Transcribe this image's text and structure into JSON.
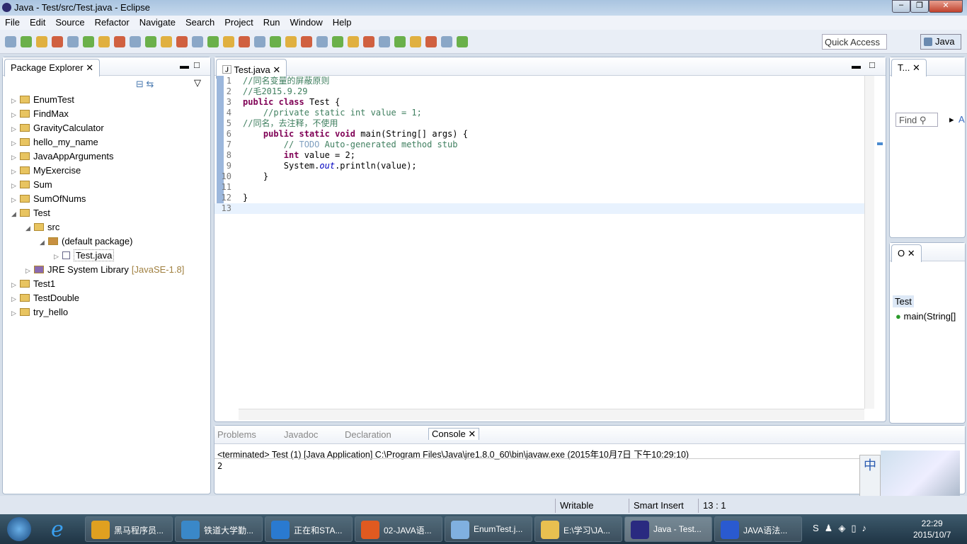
{
  "window": {
    "title": "Java - Test/src/Test.java - Eclipse"
  },
  "menu": [
    "File",
    "Edit",
    "Source",
    "Refactor",
    "Navigate",
    "Search",
    "Project",
    "Run",
    "Window",
    "Help"
  ],
  "toolbar": {
    "quick_access_placeholder": "Quick Access",
    "perspective": "Java"
  },
  "package_explorer": {
    "title": "Package Explorer",
    "items": [
      {
        "label": "EnumTest",
        "level": 0,
        "expanded": false,
        "icon": "project-folder-icon"
      },
      {
        "label": "FindMax",
        "level": 0,
        "expanded": false,
        "icon": "project-folder-icon"
      },
      {
        "label": "GravityCalculator",
        "level": 0,
        "expanded": false,
        "icon": "project-folder-icon"
      },
      {
        "label": "hello_my_name",
        "level": 0,
        "expanded": false,
        "icon": "project-folder-icon"
      },
      {
        "label": "JavaAppArguments",
        "level": 0,
        "expanded": false,
        "icon": "project-folder-icon"
      },
      {
        "label": "MyExercise",
        "level": 0,
        "expanded": false,
        "icon": "project-folder-icon"
      },
      {
        "label": "Sum",
        "level": 0,
        "expanded": false,
        "icon": "project-folder-icon"
      },
      {
        "label": "SumOfNums",
        "level": 0,
        "expanded": false,
        "icon": "project-folder-icon"
      },
      {
        "label": "Test",
        "level": 0,
        "expanded": true,
        "icon": "project-folder-icon"
      },
      {
        "label": "src",
        "level": 1,
        "expanded": true,
        "icon": "source-folder-icon"
      },
      {
        "label": "(default package)",
        "level": 2,
        "expanded": true,
        "icon": "package-icon"
      },
      {
        "label": "Test.java",
        "level": 3,
        "expanded": false,
        "icon": "java-file-icon"
      },
      {
        "label": "JRE System Library",
        "suffix": "[JavaSE-1.8]",
        "level": 1,
        "expanded": false,
        "icon": "library-icon"
      },
      {
        "label": "Test1",
        "level": 0,
        "expanded": false,
        "icon": "project-folder-icon"
      },
      {
        "label": "TestDouble",
        "level": 0,
        "expanded": false,
        "icon": "project-folder-icon"
      },
      {
        "label": "try_hello",
        "level": 0,
        "expanded": false,
        "icon": "project-folder-icon"
      }
    ]
  },
  "editor": {
    "tab": "Test.java",
    "lines": [
      "//同名变量的屏蔽原则",
      "//毛2015.9.29",
      "public class Test {",
      "    //private static int value = 1;",
      "//同名，去注释，不使用",
      "    public static void main(String[] args) {",
      "        // TODO Auto-generated method stub",
      "        int value = 2;",
      "        System.out.println(value);",
      "    }",
      "",
      "}",
      ""
    ]
  },
  "console": {
    "tabs": [
      "Problems",
      "Javadoc",
      "Declaration",
      "Console"
    ],
    "active": "Console",
    "header": "<terminated> Test (1) [Java Application] C:\\Program Files\\Java\\jre1.8.0_60\\bin\\javaw.exe (2015年10月7日 下午10:29:10)",
    "output": "2"
  },
  "task_list": {
    "title": "T...",
    "find_placeholder": "Find",
    "all_label": "A"
  },
  "outline": {
    "title": "O",
    "class": "Test",
    "method": "main(String[]"
  },
  "status": {
    "writable": "Writable",
    "insert": "Smart Insert",
    "position": "13 : 1"
  },
  "ime": {
    "lang": "中"
  },
  "taskbar": {
    "items": [
      "黑马程序员...",
      "铁道大学勤...",
      "正在和STA...",
      "02-JAVA语...",
      "EnumTest.j...",
      "E:\\学习\\JA...",
      "Java - Test...",
      "JAVA语法..."
    ],
    "colors": [
      "#e0a020",
      "#3a88c8",
      "#2a7ad0",
      "#e05a20",
      "#80b0e0",
      "#e8c050",
      "#2a2a80",
      "#2a5ad0"
    ],
    "time": "22:29",
    "date": "2015/10/7"
  }
}
